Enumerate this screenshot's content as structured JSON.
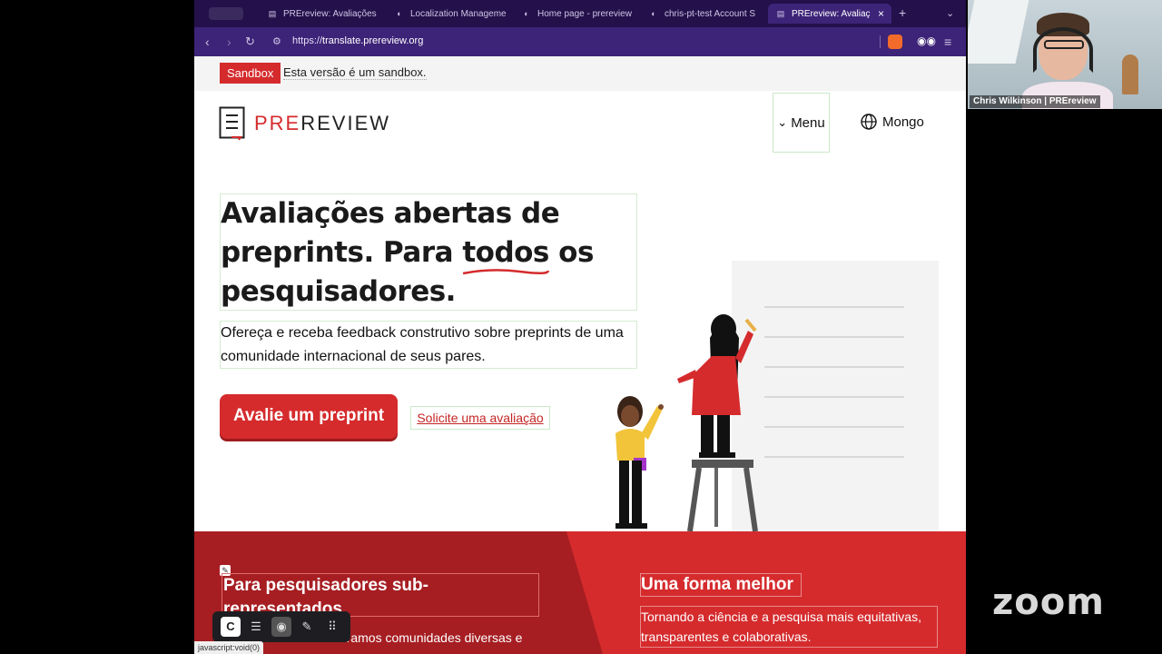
{
  "browser": {
    "tabs": [
      {
        "title": "PREreview: Avaliações",
        "icon": "doc-icon",
        "active": false
      },
      {
        "title": "Localization Manageme",
        "icon": "crowdin-icon",
        "active": false
      },
      {
        "title": "Home page - prereview",
        "icon": "crowdin-icon",
        "active": false
      },
      {
        "title": "chris-pt-test Account S",
        "icon": "crowdin-icon",
        "active": false
      },
      {
        "title": "PREreview: Avaliaç",
        "icon": "doc-icon",
        "active": true
      }
    ],
    "url_scheme": "https://",
    "url_host": "translate.prereview.org",
    "accent": "#3d2478"
  },
  "sandbox": {
    "badge": "Sandbox",
    "text": "Esta versão é um sandbox."
  },
  "header": {
    "logo_pre": "PRE",
    "logo_rest": "REVIEW",
    "menu_label": "Menu",
    "language_label": "Mongo"
  },
  "hero": {
    "title_part1": "Avaliações abertas de preprints. Para ",
    "title_highlight": "todos",
    "title_part2": " os pesquisadores.",
    "subtitle": "Ofereça e receba feedback construtivo sobre preprints de uma comunidade internacional de seus pares.",
    "cta_primary": "Avalie um preprint",
    "cta_secondary": "Solicite uma avaliação"
  },
  "band": {
    "left_title": "Para pesquisadores sub-representados",
    "left_text": "...ramos comunidades diversas e",
    "right_title": "Uma forma melhor",
    "right_text": "Tornando a ciência e a pesquisa mais equitativas, transparentes e colaborativas."
  },
  "status_bar": "javascript:void(0)",
  "video": {
    "participant_name": "Chris Wilkinson | PREreview"
  },
  "zoom_brand": "zoom",
  "colors": {
    "brand_red": "#d52b2d",
    "dark_red": "#a61e22",
    "tab_bg": "#24104a"
  }
}
